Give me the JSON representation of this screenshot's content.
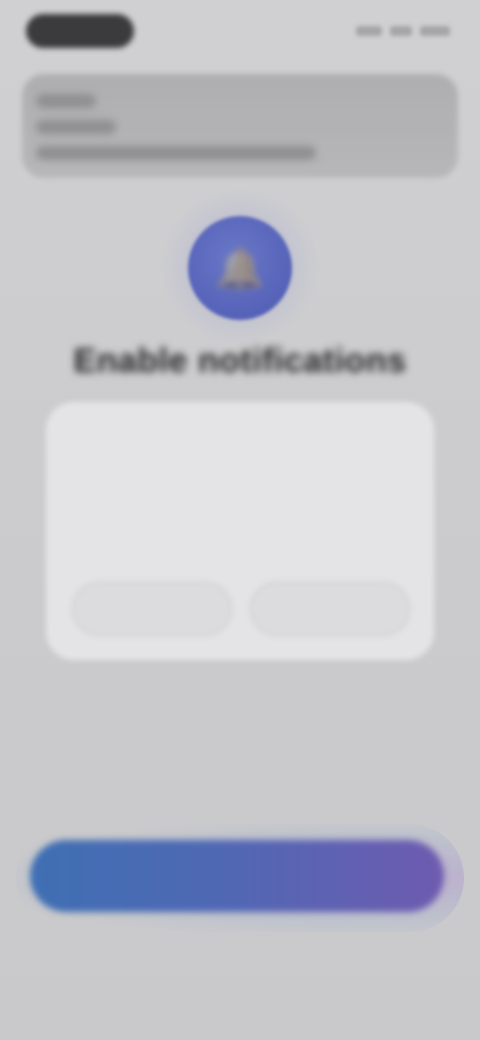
{
  "status_bar": {
    "time": "",
    "icons": [
      "signal-icon",
      "wifi-icon",
      "battery-icon"
    ]
  },
  "banner": {
    "lines": [
      "",
      "",
      ""
    ]
  },
  "hero": {
    "icon": "bell-icon",
    "accent_color": "#5a66b8",
    "title": "Enable notifications"
  },
  "dialog": {
    "title": "",
    "body": "",
    "buttons": {
      "dont_allow": "",
      "allow": ""
    }
  },
  "cta": {
    "label": "",
    "gradient_start": "#3f6fb3",
    "gradient_end": "#6e5bb0"
  },
  "secondary_link": {
    "label": ""
  }
}
